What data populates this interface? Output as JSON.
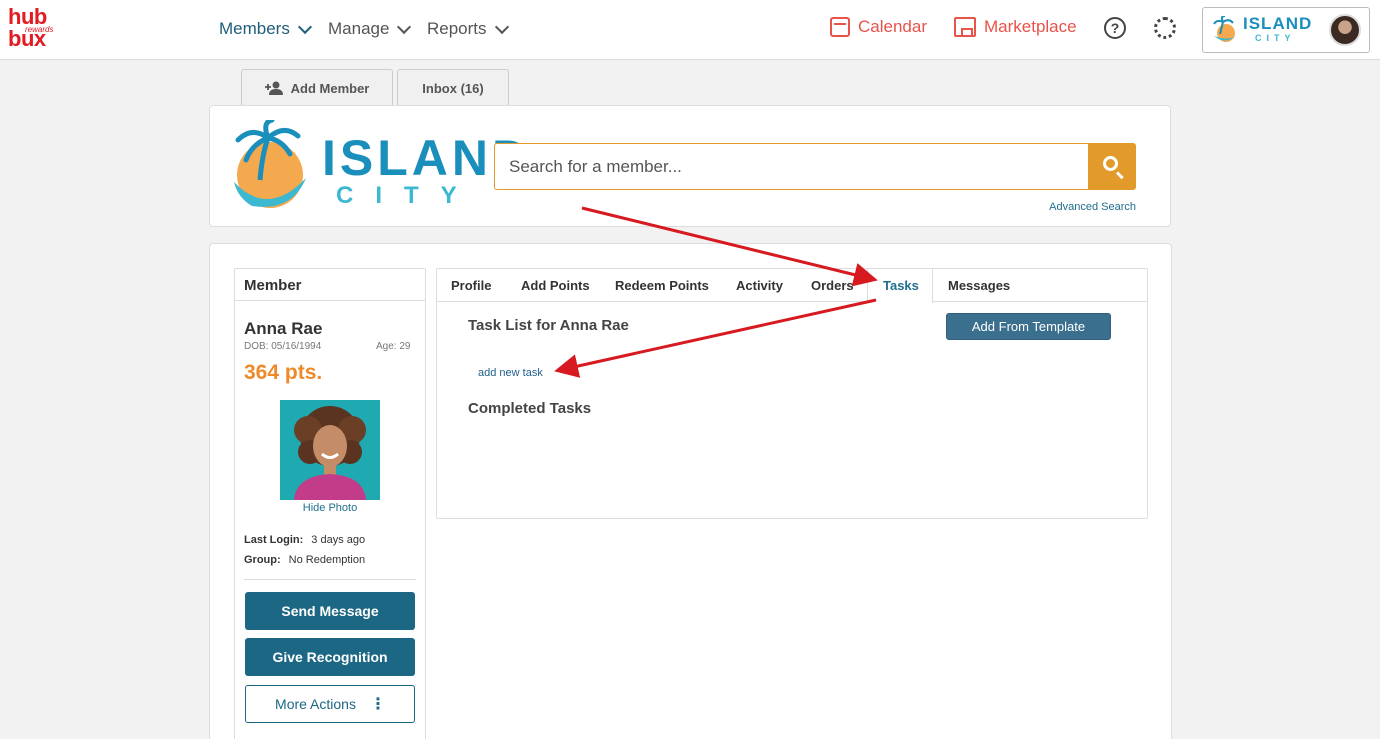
{
  "brand": {
    "hub": "hub",
    "bux": "bux",
    "rewards": "rewards"
  },
  "nav": {
    "members": "Members",
    "manage": "Manage",
    "reports": "Reports",
    "calendar": "Calendar",
    "marketplace": "Marketplace",
    "help_glyph": "?"
  },
  "org": {
    "name": "ISLAND",
    "sub": "CITY"
  },
  "page_tabs": {
    "add_member": "Add Member",
    "inbox": "Inbox (16)"
  },
  "search": {
    "placeholder": "Search for a member...",
    "advanced": "Advanced Search"
  },
  "member": {
    "heading": "Member",
    "name": "Anna Rae",
    "dob": "DOB: 05/16/1994",
    "age": "Age:  29",
    "points": "364 pts.",
    "hide_photo": "Hide Photo",
    "last_login_label": "Last Login:",
    "last_login_value": "3 days ago",
    "group_label": "Group:",
    "group_value": "No Redemption",
    "send_message": "Send Message",
    "give_recognition": "Give Recognition",
    "more_actions": "More Actions",
    "kebab_glyph": "⋮"
  },
  "tabs": {
    "profile": "Profile",
    "add_points": "Add Points",
    "redeem_points": "Redeem Points",
    "activity": "Activity",
    "orders": "Orders",
    "tasks": "Tasks",
    "messages": "Messages"
  },
  "tasks": {
    "title": "Task List for Anna Rae",
    "add_from_template": "Add From Template",
    "add_new_task": "add new task",
    "completed": "Completed Tasks"
  },
  "colors": {
    "accent": "#1c6784",
    "search": "#e29a2b",
    "points": "#ef8a2a",
    "annotation": "#d71920"
  }
}
